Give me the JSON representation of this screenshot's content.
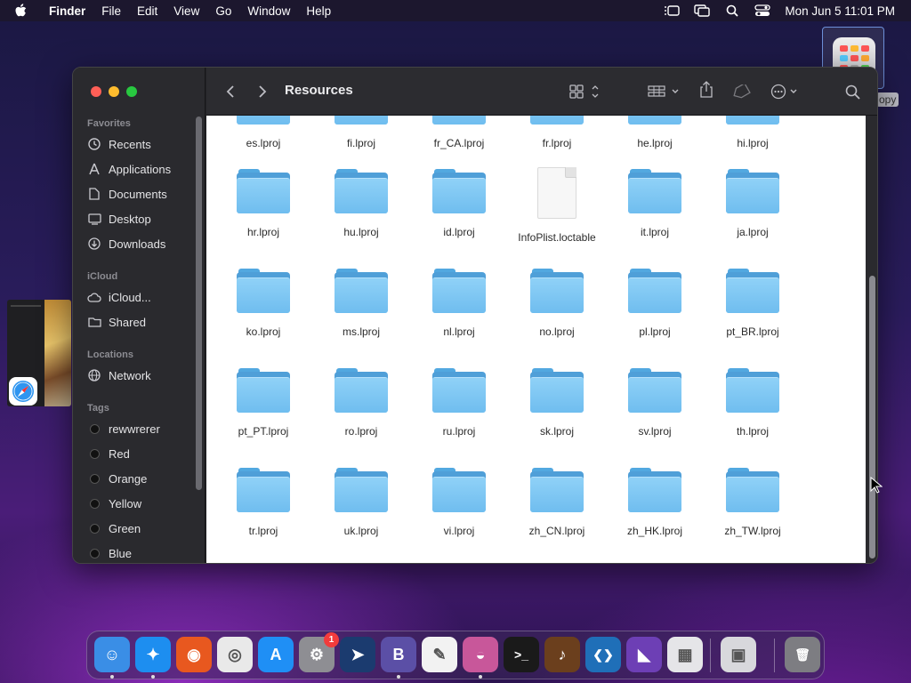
{
  "menubar": {
    "app_name": "Finder",
    "menus": [
      "File",
      "Edit",
      "View",
      "Go",
      "Window",
      "Help"
    ],
    "clock": "Mon Jun 5  11:01 PM"
  },
  "thumbnail_label": "opy",
  "finder": {
    "title": "Resources",
    "sidebar": {
      "favorites_header": "Favorites",
      "favorites": [
        {
          "label": "Recents",
          "icon": "clock-icon"
        },
        {
          "label": "Applications",
          "icon": "applications-icon"
        },
        {
          "label": "Documents",
          "icon": "document-icon"
        },
        {
          "label": "Desktop",
          "icon": "desktop-icon"
        },
        {
          "label": "Downloads",
          "icon": "downloads-icon"
        }
      ],
      "icloud_header": "iCloud",
      "icloud": [
        {
          "label": "iCloud...",
          "icon": "cloud-icon"
        },
        {
          "label": "Shared",
          "icon": "shared-folder-icon"
        }
      ],
      "locations_header": "Locations",
      "locations": [
        {
          "label": "Network",
          "icon": "globe-icon"
        }
      ],
      "tags_header": "Tags",
      "tags": [
        "rewwrerer",
        "Red",
        "Orange",
        "Yellow",
        "Green",
        "Blue"
      ]
    },
    "files": [
      [
        "es.lproj",
        "fi.lproj",
        "fr_CA.lproj",
        "fr.lproj",
        "he.lproj",
        "hi.lproj"
      ],
      [
        "hr.lproj",
        "hu.lproj",
        "id.lproj",
        "InfoPlist.loctable",
        "it.lproj",
        "ja.lproj"
      ],
      [
        "ko.lproj",
        "ms.lproj",
        "nl.lproj",
        "no.lproj",
        "pl.lproj",
        "pt_BR.lproj"
      ],
      [
        "pt_PT.lproj",
        "ro.lproj",
        "ru.lproj",
        "sk.lproj",
        "sv.lproj",
        "th.lproj"
      ],
      [
        "tr.lproj",
        "uk.lproj",
        "vi.lproj",
        "zh_CN.lproj",
        "zh_HK.lproj",
        "zh_TW.lproj"
      ]
    ],
    "document_files": [
      "InfoPlist.loctable"
    ]
  },
  "dock": {
    "apps": [
      {
        "name": "finder-app",
        "color": "#3a8ee6",
        "glyph": "☺",
        "running": true
      },
      {
        "name": "safari-app",
        "color": "#1d8ef0",
        "glyph": "✦",
        "running": true
      },
      {
        "name": "firefox-app",
        "color": "#e8581f",
        "glyph": "◉",
        "running": false
      },
      {
        "name": "chrome-app",
        "color": "#e9e9e9",
        "glyph": "◎",
        "running": false
      },
      {
        "name": "app-store-app",
        "color": "#1f8ff5",
        "glyph": "A",
        "running": false
      },
      {
        "name": "system-settings-app",
        "color": "#8e8e93",
        "glyph": "⚙",
        "running": false,
        "badge": "1"
      },
      {
        "name": "transmit-app",
        "color": "#1b3b6f",
        "glyph": "➤",
        "running": false
      },
      {
        "name": "bbedit-app",
        "color": "#5b4fa6",
        "glyph": "B",
        "running": true
      },
      {
        "name": "textedit-app",
        "color": "#f2f2f2",
        "glyph": "✎",
        "running": false
      },
      {
        "name": "monterey-app",
        "color": "#c8579a",
        "glyph": "◒",
        "running": true
      },
      {
        "name": "terminal-app",
        "color": "#1a1a1a",
        "glyph": ">_",
        "running": false
      },
      {
        "name": "instruments-app",
        "color": "#6b3f1d",
        "glyph": "♪",
        "running": false
      },
      {
        "name": "vscode-app",
        "color": "#1f6fb8",
        "glyph": "❮❯",
        "running": false
      },
      {
        "name": "visual-studio-app",
        "color": "#6d3fb5",
        "glyph": "◣",
        "running": false
      },
      {
        "name": "launchpad-app",
        "color": "#e5e5e8",
        "glyph": "▦",
        "running": false
      },
      {
        "name": "preview-app",
        "color": "#d8d8dc",
        "glyph": "▣",
        "running": false
      },
      {
        "name": "trash-app",
        "color": "#7d7d82",
        "glyph": "🗑",
        "running": false
      }
    ]
  }
}
